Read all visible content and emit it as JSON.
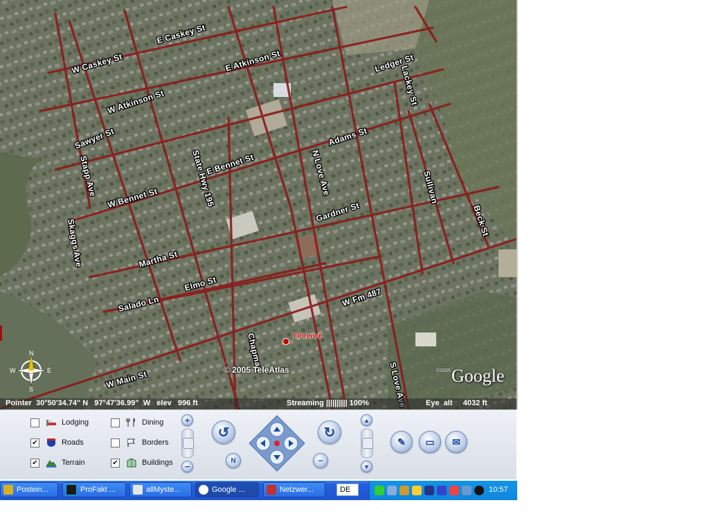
{
  "map": {
    "roads": [
      "W Caskey St",
      "E Caskey St",
      "E Atkinson St",
      "Ledger St",
      "Lackey St",
      "W Atkinson St",
      "Sawyer St",
      "Adams St",
      "State Hwy 195",
      "E Bennet St",
      "Stapp Ave",
      "N Love Ave",
      "W Bennet St",
      "Sullivan",
      "Skaggs Ave",
      "Gardner St",
      "Beck St",
      "Martha St",
      "Elmo St",
      "W Fm 487",
      "Salado Ln",
      "Chapman",
      "W Main St",
      "S Love Ave"
    ],
    "place_label": "Florence",
    "copyright": "© 2005 TeleAtlas",
    "small_copyright": "©2005",
    "logo": "Google",
    "compass": {
      "n": "N",
      "s": "S",
      "e": "E",
      "w": "W"
    }
  },
  "status_bar": {
    "pointer": "Pointer  30°50'34.74\" N   97°47'36.99\"  W   elev   996 ft",
    "streaming": "Streaming |||||||||| 100%",
    "eye_alt": "Eye  alt     4032 ft"
  },
  "layers": [
    {
      "label": "Lodging",
      "checked": false,
      "icon": "bed-icon"
    },
    {
      "label": "Dining",
      "checked": false,
      "icon": "fork-knife-icon"
    },
    {
      "label": "Roads",
      "checked": true,
      "icon": "highway-shield-icon"
    },
    {
      "label": "Borders",
      "checked": false,
      "icon": "flag-icon"
    },
    {
      "label": "Terrain",
      "checked": true,
      "icon": "mountain-icon"
    },
    {
      "label": "Buildings",
      "checked": true,
      "icon": "building-icon"
    }
  ],
  "nav": {
    "north_label": "N"
  },
  "taskbar": {
    "items": [
      "Postein...",
      "ProFakt ...",
      "allMyste...",
      "Google ...",
      "Netzwer..."
    ],
    "language": "DE",
    "clock": "10:57"
  },
  "colors": {
    "road": "#8b1a1a",
    "panel_bg": "#e4e9f0",
    "taskbar": "#245edb",
    "tray": "#0e86dc"
  }
}
